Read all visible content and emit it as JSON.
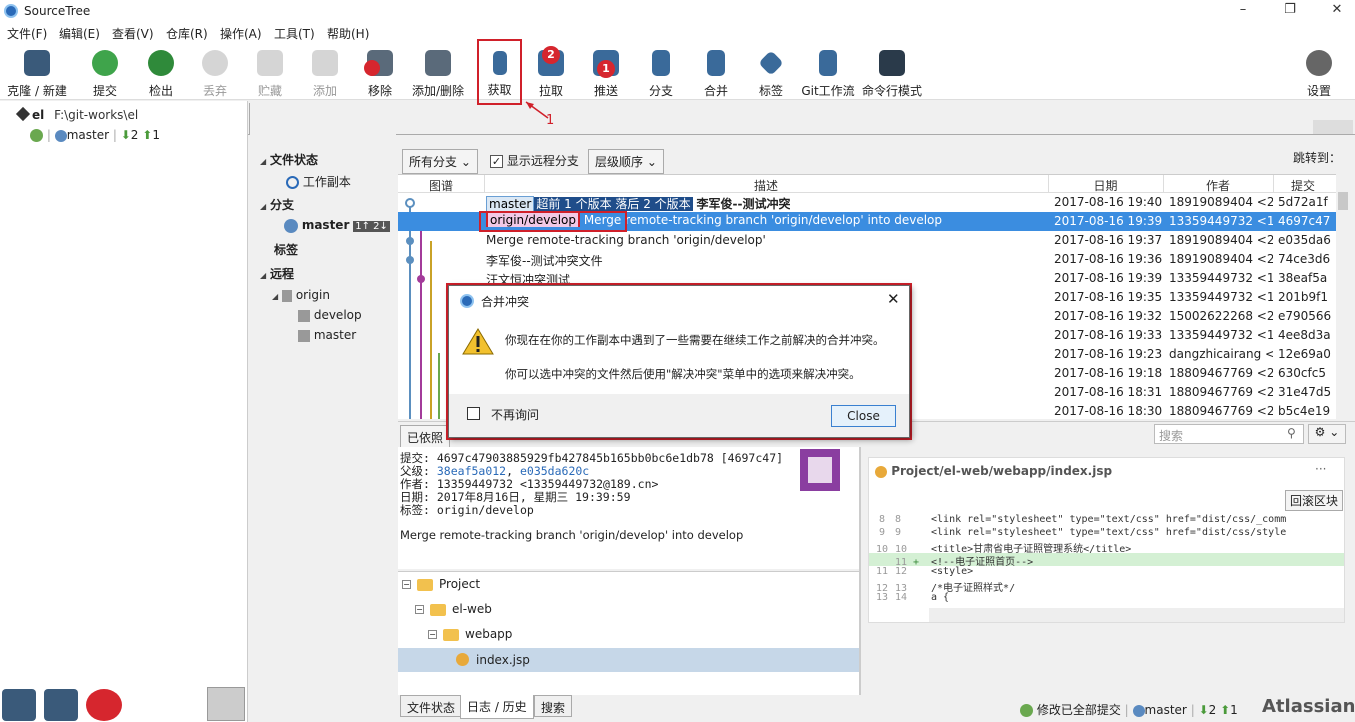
{
  "app": {
    "title": "SourceTree"
  },
  "menu": [
    "文件(F)",
    "编辑(E)",
    "查看(V)",
    "仓库(R)",
    "操作(A)",
    "工具(T)",
    "帮助(H)"
  ],
  "toolbar": {
    "clone": "克隆 / 新建",
    "commit": "提交",
    "checkout": "检出",
    "discard": "丢弃",
    "stash": "贮藏",
    "add": "添加",
    "remove": "移除",
    "add_remove": "添加/删除",
    "fetch": "获取",
    "pull": "拉取",
    "pull_badge": "2",
    "push": "推送",
    "push_badge": "1",
    "branch": "分支",
    "merge": "合并",
    "tag": "标签",
    "gitflow": "Git工作流",
    "terminal": "命令行模式",
    "settings": "设置"
  },
  "annotation": {
    "label": "1"
  },
  "repo": {
    "name": "el",
    "path": "F:\\git-works\\el",
    "branch": "master",
    "behind": "2",
    "ahead": "1"
  },
  "tab": {
    "name": "el"
  },
  "sidebar": {
    "file_status": "文件状态",
    "working_copy": "工作副本",
    "branches": "分支",
    "master": "master",
    "master_badge": "1↑ 2↓",
    "tags": "标签",
    "remotes": "远程",
    "origin": "origin",
    "origin_develop": "develop",
    "origin_master": "master"
  },
  "graph_toolbar": {
    "branches_select": "所有分支",
    "show_remote": "显示远程分支",
    "order_select": "层级顺序",
    "jump_to": "跳转到："
  },
  "columns": {
    "graph": "图谱",
    "desc": "描述",
    "date": "日期",
    "author": "作者",
    "commit": "提交"
  },
  "commits": [
    {
      "tag": "master",
      "tag_note": "超前 1 个版本 落后 2 个版本",
      "desc": "李军俊--测试冲突",
      "date": "2017-08-16 19:40",
      "author": "18919089404 <2",
      "hash": "5d72a1f"
    },
    {
      "tag": "origin/develop",
      "desc": "Merge remote-tracking branch 'origin/develop' into develop",
      "date": "2017-08-16 19:39",
      "author": "13359449732 <1",
      "hash": "4697c47"
    },
    {
      "desc": "Merge remote-tracking branch 'origin/develop'",
      "date": "2017-08-16 19:37",
      "author": "18919089404 <2",
      "hash": "e035da6"
    },
    {
      "desc": "李军俊--测试冲突文件",
      "date": "2017-08-16 19:36",
      "author": "18919089404 <2",
      "hash": "74ce3d6"
    },
    {
      "desc": "汪文恒冲突测试",
      "date": "2017-08-16 19:39",
      "author": "13359449732 <1",
      "hash": "38eaf5a"
    },
    {
      "desc": "",
      "date": "2017-08-16 19:35",
      "author": "13359449732 <1",
      "hash": "201b9f1"
    },
    {
      "desc": "",
      "date": "2017-08-16 19:32",
      "author": "15002622268 <2",
      "hash": "e790566"
    },
    {
      "desc": "",
      "date": "2017-08-16 19:33",
      "author": "13359449732 <1",
      "hash": "4ee8d3a"
    },
    {
      "desc": "",
      "date": "2017-08-16 19:23",
      "author": "dangzhicairang <",
      "hash": "12e69a0"
    },
    {
      "desc": "",
      "date": "2017-08-16 19:18",
      "author": "18809467769 <2",
      "hash": "630cfc5"
    },
    {
      "desc": "",
      "date": "2017-08-16 18:31",
      "author": "18809467769 <2",
      "hash": "31e47d5"
    },
    {
      "desc": "",
      "date": "2017-08-16 18:30",
      "author": "18809467769 <2",
      "hash": "b5c4e19"
    }
  ],
  "detail_tabs": {
    "sorted": "已依照"
  },
  "search": {
    "placeholder": "搜索"
  },
  "detail": {
    "commit_label": "提交:",
    "commit": "4697c47903885929fb427845b165bb0bc6e1db78 [4697c47]",
    "parents_label": "父级:",
    "parent1": "38eaf5a012",
    "parent2": "e035da620c",
    "author_label": "作者:",
    "author": "13359449732 <13359449732@189.cn>",
    "date_label": "日期:",
    "date": "2017年8月16日, 星期三 19:39:59",
    "tags_label": "标签:",
    "tags": "origin/develop",
    "message": "Merge remote-tracking branch 'origin/develop' into develop"
  },
  "file_tree": {
    "project": "Project",
    "elweb": "el-web",
    "webapp": "webapp",
    "file": "index.jsp"
  },
  "diff": {
    "path": "Project/el-web/webapp/index.jsp",
    "more": "···",
    "revert": "回滚区块",
    "lines": [
      {
        "o": "8",
        "n": "8",
        "m": "",
        "t": "        <link rel=\"stylesheet\" type=\"text/css\" href=\"dist/css/_comm"
      },
      {
        "o": "9",
        "n": "9",
        "m": "",
        "t": "        <link rel=\"stylesheet\" type=\"text/css\" href=\"dist/css/style"
      },
      {
        "o": "10",
        "n": "10",
        "m": "",
        "t": "        <title>甘肃省电子证照管理系统</title>"
      },
      {
        "o": "",
        "n": "11",
        "m": "+",
        "t": "        <!--电子证照首页-->"
      },
      {
        "o": "11",
        "n": "12",
        "m": "",
        "t": "        <style>"
      },
      {
        "o": "12",
        "n": "13",
        "m": "",
        "t": "            /*电子证照样式*/"
      },
      {
        "o": "13",
        "n": "14",
        "m": "",
        "t": "            a {"
      }
    ]
  },
  "bottom_tabs": {
    "file_status": "文件状态",
    "log": "日志 / 历史",
    "search": "搜索"
  },
  "status": {
    "committed": "修改已全部提交",
    "branch": "master",
    "behind": "2",
    "ahead": "1",
    "brand": "Atlassian"
  },
  "dialog": {
    "title": "合并冲突",
    "line1": "你现在在你的工作副本中遇到了一些需要在继续工作之前解决的合并冲突。",
    "line2": "你可以选中冲突的文件然后使用\"解决冲突\"菜单中的选项来解决冲突。",
    "dont_ask": "不再询问",
    "close": "Close"
  }
}
